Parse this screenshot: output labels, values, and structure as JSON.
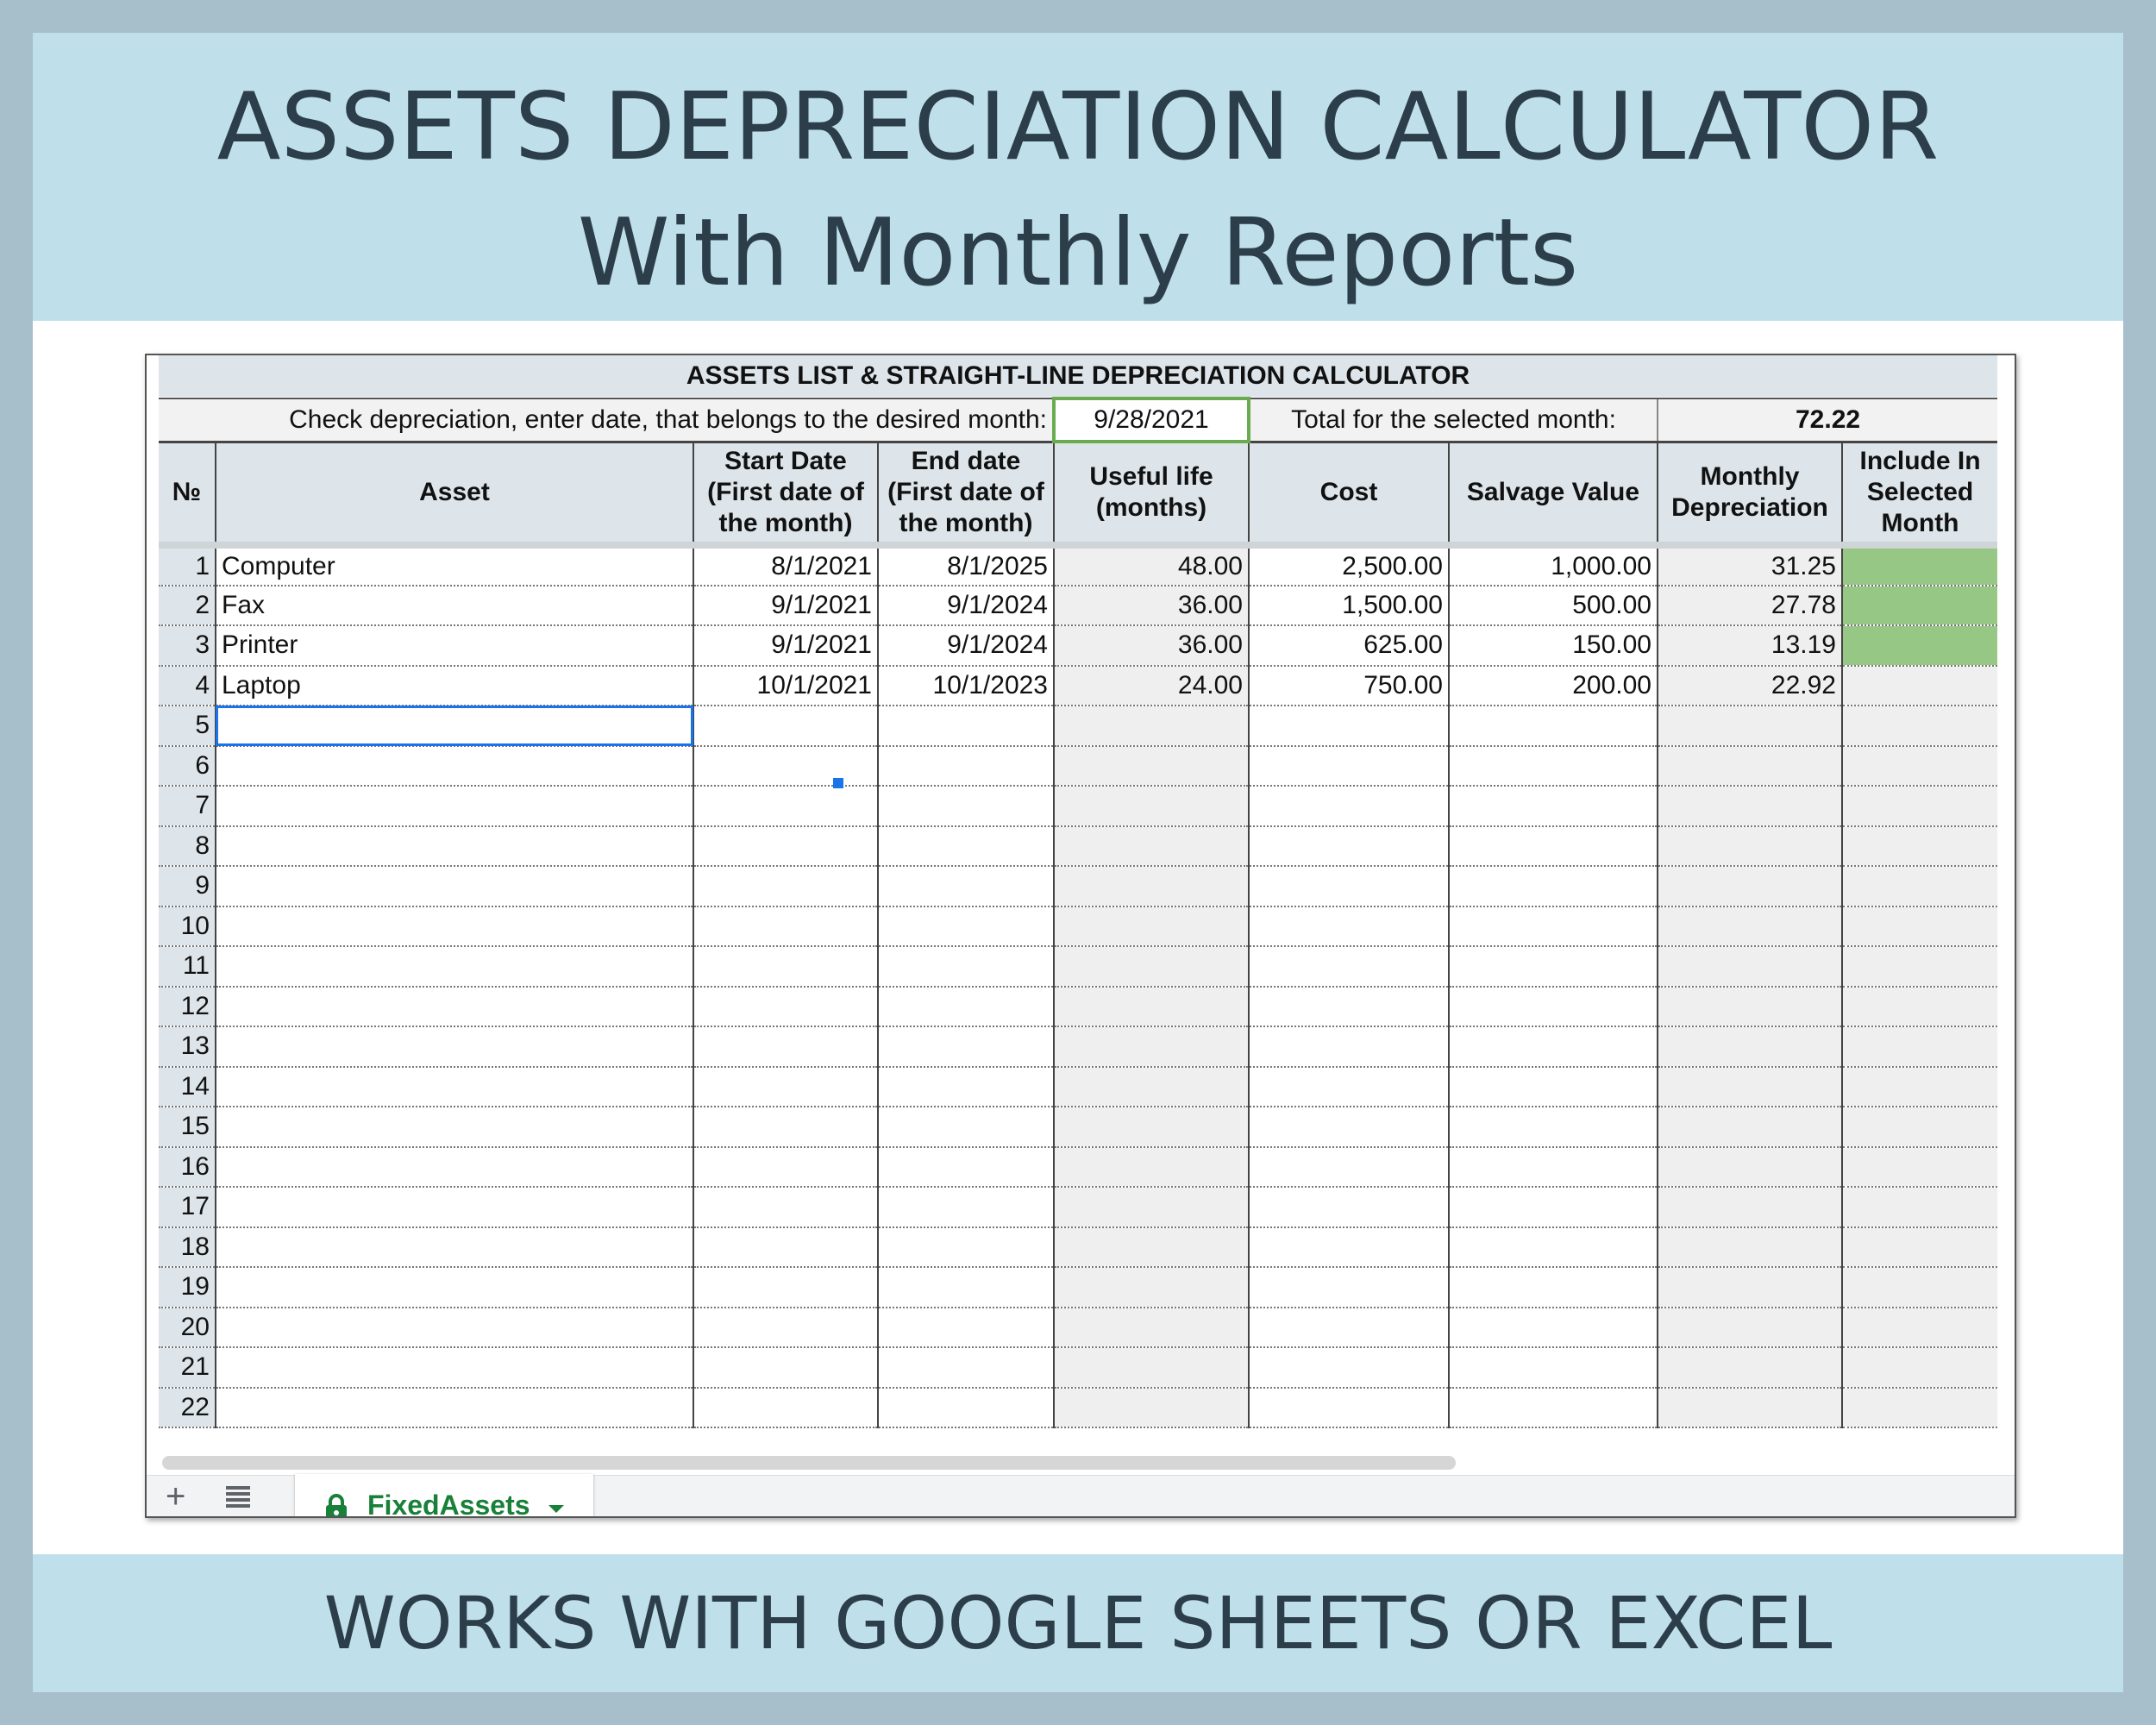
{
  "banner": {
    "title_line1": "ASSETS DEPRECIATION CALCULATOR",
    "title_line2": "With Monthly Reports",
    "footer": "WORKS WITH GOOGLE SHEETS OR EXCEL"
  },
  "sheet": {
    "title": "ASSETS LIST & STRAIGHT-LINE DEPRECIATION CALCULATOR",
    "check_label": "Check depreciation, enter date, that belongs to the desired month:",
    "check_date": "9/28/2021",
    "total_label": "Total for the selected month:",
    "total_value": "72.22",
    "headers": [
      "№",
      "Asset",
      "Start Date (First date of the month)",
      "End date (First date of the month)",
      "Useful life (months)",
      "Cost",
      "Salvage Value",
      "Monthly Depreciation",
      "Include In Selected Month"
    ],
    "rows": [
      {
        "n": "1",
        "asset": "Computer",
        "start": "8/1/2021",
        "end": "8/1/2025",
        "life": "48.00",
        "cost": "2,500.00",
        "salvage": "1,000.00",
        "monthly": "31.25",
        "included": true
      },
      {
        "n": "2",
        "asset": "Fax",
        "start": "9/1/2021",
        "end": "9/1/2024",
        "life": "36.00",
        "cost": "1,500.00",
        "salvage": "500.00",
        "monthly": "27.78",
        "included": true
      },
      {
        "n": "3",
        "asset": "Printer",
        "start": "9/1/2021",
        "end": "9/1/2024",
        "life": "36.00",
        "cost": "625.00",
        "salvage": "150.00",
        "monthly": "13.19",
        "included": true
      },
      {
        "n": "4",
        "asset": "Laptop",
        "start": "10/1/2021",
        "end": "10/1/2023",
        "life": "24.00",
        "cost": "750.00",
        "salvage": "200.00",
        "monthly": "22.92",
        "included": false
      },
      {
        "n": "5"
      },
      {
        "n": "6"
      },
      {
        "n": "7"
      },
      {
        "n": "8"
      },
      {
        "n": "9"
      },
      {
        "n": "10"
      },
      {
        "n": "11"
      },
      {
        "n": "12"
      },
      {
        "n": "13"
      },
      {
        "n": "14"
      },
      {
        "n": "15"
      },
      {
        "n": "16"
      },
      {
        "n": "17"
      },
      {
        "n": "18"
      },
      {
        "n": "19"
      },
      {
        "n": "20"
      },
      {
        "n": "21"
      },
      {
        "n": "22"
      }
    ],
    "tab_name": "FixedAssets"
  },
  "icons": {
    "add_sheet": "plus-icon",
    "all_sheets": "list-icon",
    "protected": "lock-icon",
    "tab_menu": "caret-down-icon"
  },
  "colors": {
    "banner": "#bfe0eb",
    "background": "#a6bfca",
    "included": "#97c784",
    "date_border": "#6aab4f",
    "tab_text": "#188038",
    "selection": "#1a73e8"
  }
}
